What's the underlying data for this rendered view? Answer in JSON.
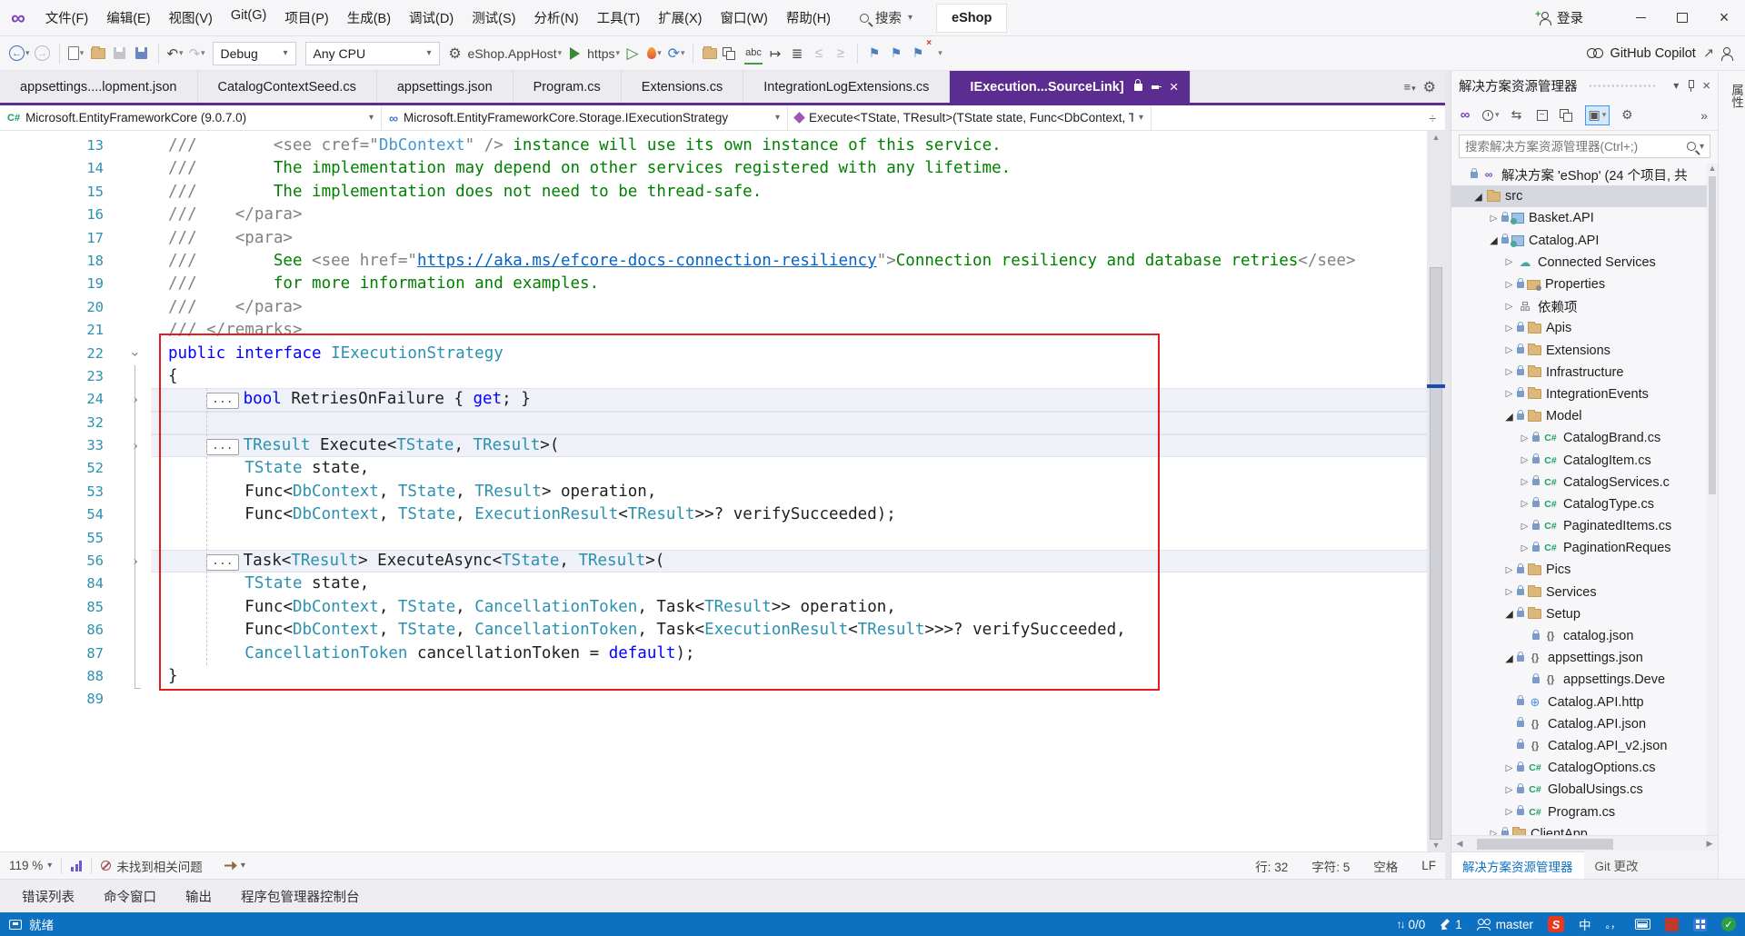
{
  "title_bar": {
    "menus": [
      "文件(F)",
      "编辑(E)",
      "视图(V)",
      "Git(G)",
      "项目(P)",
      "生成(B)",
      "调试(D)",
      "测试(S)",
      "分析(N)",
      "工具(T)",
      "扩展(X)",
      "窗口(W)",
      "帮助(H)"
    ],
    "search_label": "搜索",
    "solution_name": "eShop",
    "sign_in_label": "登录"
  },
  "toolbar": {
    "debug_config": "Debug",
    "platform": "Any CPU",
    "startup_project": "eShop.AppHost",
    "run_profile": "https",
    "copilot_label": "GitHub Copilot"
  },
  "editor_tabs": [
    {
      "label": "appsettings....lopment.json",
      "active": false
    },
    {
      "label": "CatalogContextSeed.cs",
      "active": false
    },
    {
      "label": "appsettings.json",
      "active": false
    },
    {
      "label": "Program.cs",
      "active": false
    },
    {
      "label": "Extensions.cs",
      "active": false
    },
    {
      "label": "IntegrationLogExtensions.cs",
      "active": false
    },
    {
      "label": "IExecution...SourceLink]",
      "active": true
    }
  ],
  "breadcrumb": [
    {
      "icon": "csharp",
      "label": "Microsoft.EntityFrameworkCore (9.0.7.0)"
    },
    {
      "icon": "link",
      "label": "Microsoft.EntityFrameworkCore.Storage.IExecutionStrategy"
    },
    {
      "icon": "method",
      "label": "Execute<TState, TResult>(TState state, Func<DbContext, TState,"
    }
  ],
  "editor": {
    "collapsed_box_text": "...",
    "lines": [
      {
        "n": 13,
        "s": [
          [
            "g",
            "///"
          ],
          [
            "c",
            "        "
          ],
          [
            "g",
            "<see cref=\""
          ],
          [
            "tb",
            "DbContext"
          ],
          [
            "g",
            "\" />"
          ],
          [
            "c",
            " instance will use its own instance of this service."
          ]
        ]
      },
      {
        "n": 14,
        "s": [
          [
            "g",
            "///"
          ],
          [
            "c",
            "        The implementation may depend on other services registered with any lifetime."
          ]
        ]
      },
      {
        "n": 15,
        "s": [
          [
            "g",
            "///"
          ],
          [
            "c",
            "        The implementation does not need to be thread-safe."
          ]
        ]
      },
      {
        "n": 16,
        "s": [
          [
            "g",
            "///    </para>"
          ]
        ]
      },
      {
        "n": 17,
        "s": [
          [
            "g",
            "///    <para>"
          ]
        ]
      },
      {
        "n": 18,
        "s": [
          [
            "g",
            "///"
          ],
          [
            "c",
            "        See "
          ],
          [
            "g",
            "<see href=\""
          ],
          [
            "u",
            "https://aka.ms/efcore-docs-connection-resiliency"
          ],
          [
            "g",
            "\">"
          ],
          [
            "c",
            "Connection resiliency and database retries"
          ],
          [
            "g",
            "</see>"
          ]
        ]
      },
      {
        "n": 19,
        "s": [
          [
            "g",
            "///"
          ],
          [
            "c",
            "        for more information and examples."
          ]
        ]
      },
      {
        "n": 20,
        "s": [
          [
            "g",
            "///    </para>"
          ]
        ]
      },
      {
        "n": 21,
        "s": [
          [
            "g",
            "/// </remarks>"
          ]
        ]
      },
      {
        "n": 22,
        "f": "down",
        "s": [
          [
            "k",
            "public"
          ],
          [
            "d",
            " "
          ],
          [
            "k",
            "interface"
          ],
          [
            "d",
            " "
          ],
          [
            "t",
            "IExecutionStrategy"
          ]
        ]
      },
      {
        "n": 23,
        "s": [
          [
            "d",
            "{"
          ]
        ]
      },
      {
        "n": 24,
        "f": "right",
        "hl": true,
        "box": true,
        "ind": 4,
        "s": [
          [
            "k",
            "bool"
          ],
          [
            "d",
            " RetriesOnFailure { "
          ],
          [
            "k",
            "get"
          ],
          [
            "d",
            "; }"
          ]
        ]
      },
      {
        "n": 32,
        "hl": true,
        "s": []
      },
      {
        "n": 33,
        "f": "right",
        "hl": true,
        "box": true,
        "ind": 4,
        "s": [
          [
            "t",
            "TResult"
          ],
          [
            "d",
            " Execute<"
          ],
          [
            "t",
            "TState"
          ],
          [
            "d",
            ", "
          ],
          [
            "t",
            "TResult"
          ],
          [
            "d",
            ">("
          ]
        ]
      },
      {
        "n": 52,
        "ind": 8,
        "s": [
          [
            "t",
            "TState"
          ],
          [
            "d",
            " state,"
          ]
        ]
      },
      {
        "n": 53,
        "ind": 8,
        "s": [
          [
            "d",
            "Func<"
          ],
          [
            "t",
            "DbContext"
          ],
          [
            "d",
            ", "
          ],
          [
            "t",
            "TState"
          ],
          [
            "d",
            ", "
          ],
          [
            "t",
            "TResult"
          ],
          [
            "d",
            "> operation,"
          ]
        ]
      },
      {
        "n": 54,
        "ind": 8,
        "s": [
          [
            "d",
            "Func<"
          ],
          [
            "t",
            "DbContext"
          ],
          [
            "d",
            ", "
          ],
          [
            "t",
            "TState"
          ],
          [
            "d",
            ", "
          ],
          [
            "t",
            "ExecutionResult"
          ],
          [
            "d",
            "<"
          ],
          [
            "t",
            "TResult"
          ],
          [
            "d",
            ">>? verifySucceeded);"
          ]
        ]
      },
      {
        "n": 55,
        "s": []
      },
      {
        "n": 56,
        "f": "right",
        "hl": true,
        "box": true,
        "ind": 4,
        "s": [
          [
            "d",
            "Task<"
          ],
          [
            "t",
            "TResult"
          ],
          [
            "d",
            "> ExecuteAsync<"
          ],
          [
            "t",
            "TState"
          ],
          [
            "d",
            ", "
          ],
          [
            "t",
            "TResult"
          ],
          [
            "d",
            ">("
          ]
        ]
      },
      {
        "n": 84,
        "ind": 8,
        "s": [
          [
            "t",
            "TState"
          ],
          [
            "d",
            " state,"
          ]
        ]
      },
      {
        "n": 85,
        "ind": 8,
        "s": [
          [
            "d",
            "Func<"
          ],
          [
            "t",
            "DbContext"
          ],
          [
            "d",
            ", "
          ],
          [
            "t",
            "TState"
          ],
          [
            "d",
            ", "
          ],
          [
            "t",
            "CancellationToken"
          ],
          [
            "d",
            ", Task<"
          ],
          [
            "t",
            "TResult"
          ],
          [
            "d",
            ">> operation,"
          ]
        ]
      },
      {
        "n": 86,
        "ind": 8,
        "s": [
          [
            "d",
            "Func<"
          ],
          [
            "t",
            "DbContext"
          ],
          [
            "d",
            ", "
          ],
          [
            "t",
            "TState"
          ],
          [
            "d",
            ", "
          ],
          [
            "t",
            "CancellationToken"
          ],
          [
            "d",
            ", Task<"
          ],
          [
            "t",
            "ExecutionResult"
          ],
          [
            "d",
            "<"
          ],
          [
            "t",
            "TResult"
          ],
          [
            "d",
            ">>>? verifySucceeded,"
          ]
        ]
      },
      {
        "n": 87,
        "ind": 8,
        "s": [
          [
            "t",
            "CancellationToken"
          ],
          [
            "d",
            " cancellationToken = "
          ],
          [
            "k",
            "default"
          ],
          [
            "d",
            ");"
          ]
        ]
      },
      {
        "n": 88,
        "s": [
          [
            "d",
            "}"
          ]
        ]
      },
      {
        "n": 89,
        "s": []
      }
    ]
  },
  "editor_status": {
    "zoom": "119 %",
    "health": "未找到相关问题",
    "line": "行: 32",
    "column": "字符: 5",
    "spaces": "空格",
    "eol": "LF"
  },
  "solution_explorer": {
    "title": "解决方案资源管理器",
    "search_placeholder": "搜索解决方案资源管理器(Ctrl+;)",
    "items": [
      {
        "lvl": 0,
        "arrow": "none",
        "lock": true,
        "icon": "solution",
        "label": "解决方案 'eShop' (24 个项目, 共"
      },
      {
        "lvl": 1,
        "arrow": "exp",
        "lock": false,
        "icon": "folder",
        "label": "src",
        "selected": true
      },
      {
        "lvl": 2,
        "arrow": "col",
        "lock": true,
        "icon": "webproj",
        "label": "Basket.API"
      },
      {
        "lvl": 2,
        "arrow": "exp",
        "lock": true,
        "icon": "webproj",
        "label": "Catalog.API"
      },
      {
        "lvl": 3,
        "arrow": "col",
        "lock": false,
        "icon": "cloud",
        "label": "Connected Services"
      },
      {
        "lvl": 3,
        "arrow": "col",
        "lock": true,
        "icon": "props",
        "label": "Properties"
      },
      {
        "lvl": 3,
        "arrow": "col",
        "lock": false,
        "icon": "deps",
        "label": "依赖项"
      },
      {
        "lvl": 3,
        "arrow": "col",
        "lock": true,
        "icon": "folder",
        "label": "Apis"
      },
      {
        "lvl": 3,
        "arrow": "col",
        "lock": true,
        "icon": "folder",
        "label": "Extensions"
      },
      {
        "lvl": 3,
        "arrow": "col",
        "lock": true,
        "icon": "folder",
        "label": "Infrastructure"
      },
      {
        "lvl": 3,
        "arrow": "col",
        "lock": true,
        "icon": "folder",
        "label": "IntegrationEvents"
      },
      {
        "lvl": 3,
        "arrow": "exp",
        "lock": true,
        "icon": "folder",
        "label": "Model"
      },
      {
        "lvl": 4,
        "arrow": "col",
        "lock": true,
        "icon": "cs",
        "label": "CatalogBrand.cs"
      },
      {
        "lvl": 4,
        "arrow": "col",
        "lock": true,
        "icon": "cs",
        "label": "CatalogItem.cs"
      },
      {
        "lvl": 4,
        "arrow": "col",
        "lock": true,
        "icon": "cs",
        "label": "CatalogServices.c"
      },
      {
        "lvl": 4,
        "arrow": "col",
        "lock": true,
        "icon": "cs",
        "label": "CatalogType.cs"
      },
      {
        "lvl": 4,
        "arrow": "col",
        "lock": true,
        "icon": "cs",
        "label": "PaginatedItems.cs"
      },
      {
        "lvl": 4,
        "arrow": "col",
        "lock": true,
        "icon": "cs",
        "label": "PaginationReques"
      },
      {
        "lvl": 3,
        "arrow": "col",
        "lock": true,
        "icon": "folder",
        "label": "Pics"
      },
      {
        "lvl": 3,
        "arrow": "col",
        "lock": true,
        "icon": "folder",
        "label": "Services"
      },
      {
        "lvl": 3,
        "arrow": "exp",
        "lock": true,
        "icon": "folder",
        "label": "Setup"
      },
      {
        "lvl": 4,
        "arrow": "none",
        "lock": true,
        "icon": "json",
        "label": "catalog.json"
      },
      {
        "lvl": 3,
        "arrow": "exp",
        "lock": true,
        "icon": "json",
        "label": "appsettings.json"
      },
      {
        "lvl": 4,
        "arrow": "none",
        "lock": true,
        "icon": "json",
        "label": "appsettings.Deve"
      },
      {
        "lvl": 3,
        "arrow": "none",
        "lock": true,
        "icon": "http",
        "label": "Catalog.API.http"
      },
      {
        "lvl": 3,
        "arrow": "none",
        "lock": true,
        "icon": "json",
        "label": "Catalog.API.json"
      },
      {
        "lvl": 3,
        "arrow": "none",
        "lock": true,
        "icon": "json",
        "label": "Catalog.API_v2.json"
      },
      {
        "lvl": 3,
        "arrow": "col",
        "lock": true,
        "icon": "cs",
        "label": "CatalogOptions.cs"
      },
      {
        "lvl": 3,
        "arrow": "col",
        "lock": true,
        "icon": "cs",
        "label": "GlobalUsings.cs"
      },
      {
        "lvl": 3,
        "arrow": "col",
        "lock": true,
        "icon": "cs",
        "label": "Program.cs"
      },
      {
        "lvl": 2,
        "arrow": "col",
        "lock": true,
        "icon": "folder",
        "label": "ClientApp"
      }
    ],
    "bottom_tabs": [
      {
        "label": "解决方案资源管理器",
        "active": true
      },
      {
        "label": "Git 更改",
        "active": false
      }
    ]
  },
  "right_strip": {
    "tab": "属性"
  },
  "bottom_panel": {
    "tabs": [
      "错误列表",
      "命令窗口",
      "输出",
      "程序包管理器控制台"
    ]
  },
  "status_bar": {
    "ready": "就绪",
    "sync_count": "0/0",
    "pending_edits": "1",
    "branch": "master",
    "ime_logo": "S",
    "ime_lang": "中",
    "ime_punct": "。，",
    "check": "✓"
  },
  "colors": {
    "accent_purple": "#5c2d91",
    "status_blue": "#0e70c1",
    "annotation_red": "#e8191c",
    "keyword": "#0000ff",
    "type": "#2b91af",
    "comment": "#008000",
    "doc_tag_gray": "#808080",
    "line_number": "#2b91af"
  }
}
